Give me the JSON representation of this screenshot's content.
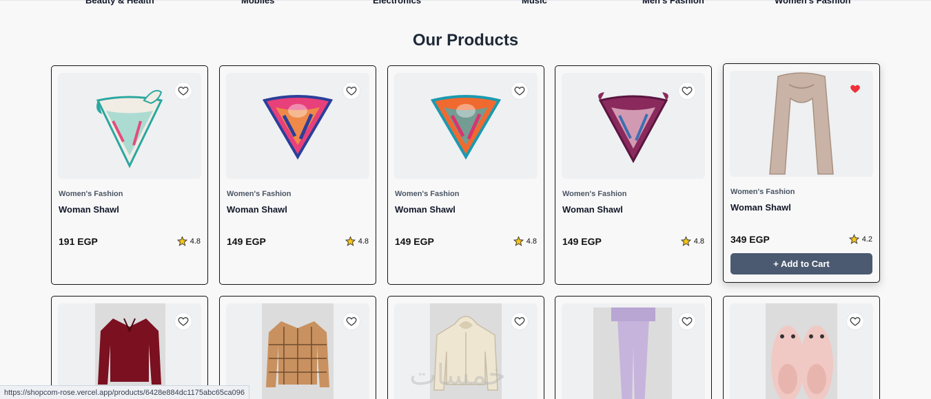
{
  "categories": [
    "Beauty & Health",
    "Mobiles",
    "Electronics",
    "Music",
    "Men's Fashion",
    "Women's Fashion"
  ],
  "section_title": "Our Products",
  "products_row1": [
    {
      "category": "Women's Fashion",
      "title": "Woman Shawl",
      "price": "191 EGP",
      "rating": "4.8",
      "favorited": false,
      "image": "scarf-white-teal-icon"
    },
    {
      "category": "Women's Fashion",
      "title": "Woman Shawl",
      "price": "149 EGP",
      "rating": "4.8",
      "favorited": false,
      "image": "scarf-pink-blue-icon"
    },
    {
      "category": "Women's Fashion",
      "title": "Woman Shawl",
      "price": "149 EGP",
      "rating": "4.8",
      "favorited": false,
      "image": "scarf-orange-teal-icon"
    },
    {
      "category": "Women's Fashion",
      "title": "Woman Shawl",
      "price": "149 EGP",
      "rating": "4.8",
      "favorited": false,
      "image": "scarf-purple-pink-icon"
    },
    {
      "category": "Women's Fashion",
      "title": "Woman Shawl",
      "price": "349 EGP",
      "rating": "4.2",
      "favorited": true,
      "image": "scarf-beige-long-icon",
      "add_to_cart": "+ Add to Cart"
    }
  ],
  "products_row2": [
    {
      "image": "red-blouse-icon"
    },
    {
      "image": "plaid-shirt-icon"
    },
    {
      "image": "cream-hoodie-icon"
    },
    {
      "image": "lavender-pants-icon"
    },
    {
      "image": "pink-slippers-icon"
    }
  ],
  "status_url": "https://shopcom-rose.vercel.app/products/6428e884dc1175abc65ca096",
  "watermark": "خمسات",
  "colors": {
    "heart_active": "#ef2f3a",
    "star": "#f5c518",
    "button": "#4b5a70"
  }
}
